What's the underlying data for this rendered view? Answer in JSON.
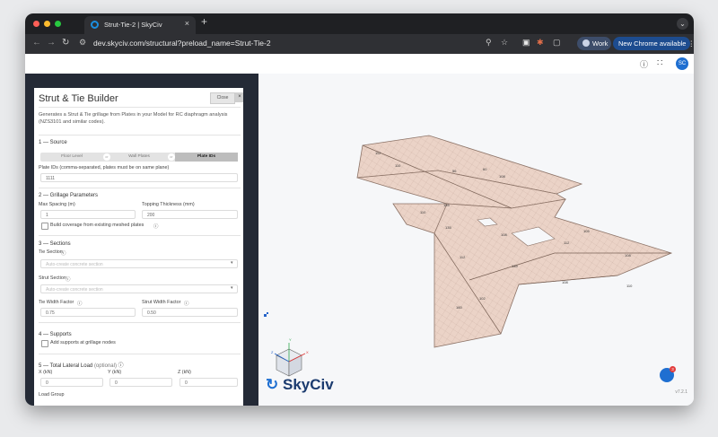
{
  "browser": {
    "tab_title": "Strut-Tie-2 | SkyCiv",
    "tab_close": "×",
    "new_tab": "+",
    "url": "dev.skyciv.com/structural?preload_name=Strut-Tie-2",
    "profile_label": "Work",
    "update_label": "New Chrome available",
    "dot_colors": [
      "#ff5f57",
      "#febc2e",
      "#28c840"
    ]
  },
  "app_header": {
    "avatar_initials": "SC"
  },
  "panel": {
    "title": "Strut & Tie Builder",
    "close_label": "Close",
    "close_x": "×",
    "description": "Generates a Strut & Tie grillage from Plates in your Model for RC diaphragm analysis (NZS3101 and similar codes).",
    "source": {
      "heading": "1 — Source",
      "options": [
        "Floor Level",
        "Wall Plates",
        "Plate IDs"
      ],
      "or_label": "or",
      "selected": "Plate IDs",
      "plate_ids_label": "Plate IDs (comma-separated, plates must be on same plane)",
      "plate_ids_value": "1111"
    },
    "grillage": {
      "heading": "2 — Grillage Parameters",
      "max_spacing_label": "Max Spacing (m)",
      "max_spacing_value": "1",
      "topping_label": "Topping Thickness (mm)",
      "topping_value": "200",
      "coverage_label": "Build coverage from existing meshed plates"
    },
    "sections": {
      "heading": "3 — Sections",
      "tie_label": "Tie Section",
      "tie_placeholder": "Auto-create concrete section",
      "strut_label": "Strut Section",
      "strut_placeholder": "Auto-create concrete section",
      "tie_width_label": "Tie Width Factor",
      "tie_width_value": "0.75",
      "strut_width_label": "Strut Width Factor",
      "strut_width_value": "0.50"
    },
    "supports": {
      "heading": "4 — Supports",
      "add_supports_label": "Add supports at grillage nodes"
    },
    "lateral": {
      "heading": "5 — Total Lateral Load",
      "optional": "(optional)",
      "x_label": "X (kN)",
      "x_value": "0",
      "y_label": "Y (kN)",
      "y_value": "0",
      "z_label": "Z (kN)",
      "z_value": "0",
      "load_group_label": "Load Group"
    }
  },
  "canvas": {
    "logo_text": "SkyCiv",
    "version": "v7.2.1",
    "chat_badge": "3",
    "axes": {
      "x": "X",
      "y": "Y",
      "z": "Z"
    },
    "plate_labels": [
      "112",
      "110",
      "56",
      "60",
      "108",
      "155",
      "110",
      "135",
      "108",
      "112",
      "112",
      "139",
      "105",
      "108",
      "102",
      "160",
      "108",
      "110"
    ],
    "mesh_color": "#e9cfc1",
    "line_color": "#c9b3a8"
  }
}
